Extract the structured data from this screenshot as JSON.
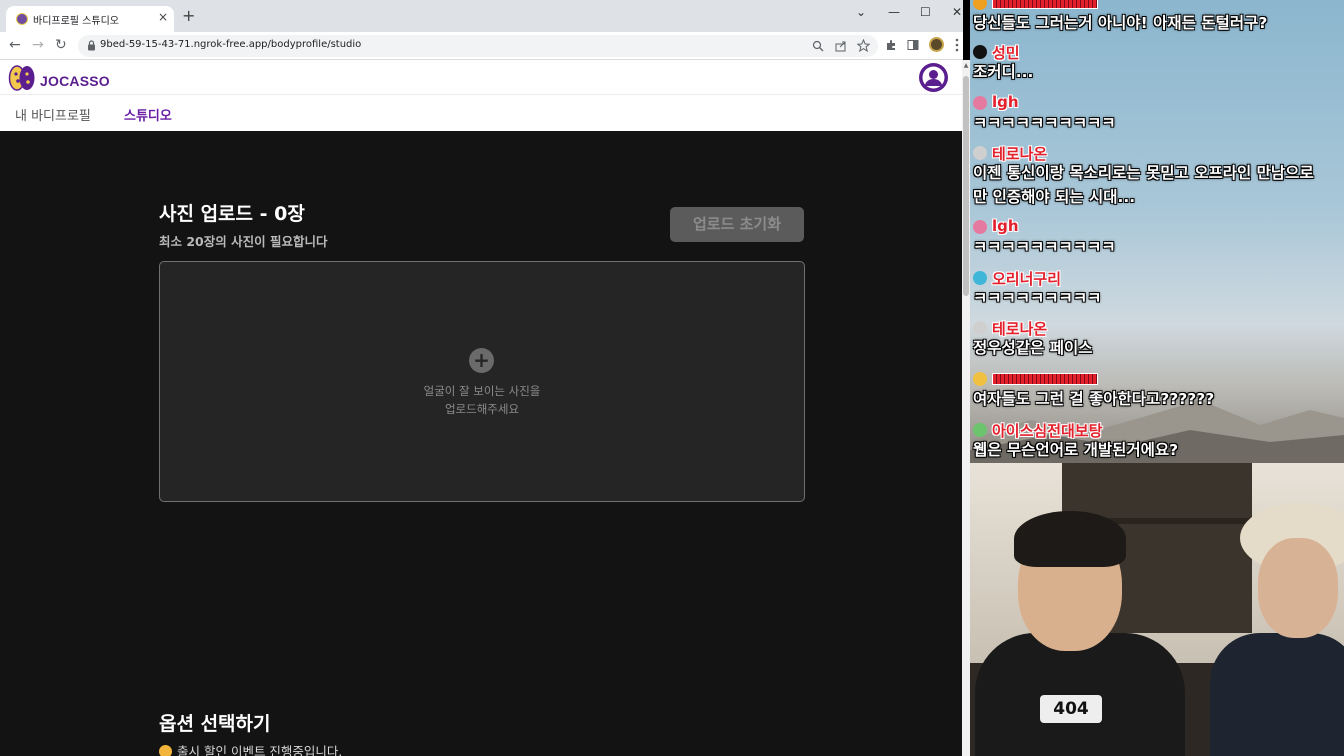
{
  "browser": {
    "tab_title": "바디프로필 스튜디오",
    "tab_close": "×",
    "new_tab": "+",
    "window_controls": {
      "minimize": "—",
      "maximize": "☐",
      "close": "✕",
      "tab_search": "⌄"
    },
    "nav": {
      "back": "←",
      "forward": "→",
      "reload": "↻"
    },
    "url": "9bed-59-15-43-71.ngrok-free.app/bodyprofile/studio",
    "icons": [
      "zoom-icon",
      "share-icon",
      "bookmark-star-icon",
      "extensions-icon",
      "sidepanel-icon",
      "profile-icon",
      "menu-icon"
    ]
  },
  "app": {
    "logo_text": "JOCASSO",
    "nav": {
      "my_profile": "내 바디프로필",
      "studio": "스튜디오"
    },
    "upload": {
      "title": "사진 업로드 - 0장",
      "subtitle": "최소 20장의 사진이 필요합니다",
      "reset_button": "업로드 초기화",
      "dropzone_plus": "+",
      "dropzone_line1": "얼굴이 잘 보이는 사진을",
      "dropzone_line2": "업로드해주세요"
    },
    "options": {
      "title": "옵션 선택하기",
      "promo": "출시 할인 이벤트 진행중입니다."
    },
    "colors": {
      "brand": "#5b1e8f",
      "active_nav": "#6a1fa6",
      "content_bg": "#131313"
    }
  },
  "stream": {
    "chat": [
      {
        "name": "",
        "name_type": "bar",
        "icon_color": "#f0a020",
        "text": "당신들도 그러는거 아니야! 아재든 돈털러구?"
      },
      {
        "name": "성민",
        "name_type": "text",
        "icon_color": "#111111",
        "text": "조커디..."
      },
      {
        "name": "lgh",
        "name_type": "text",
        "icon_color": "#e57aa0",
        "text": "ㅋㅋㅋㅋㅋㅋㅋㅋㅋㅋ"
      },
      {
        "name": "테로나온",
        "name_type": "text",
        "icon_color": "#cfcfcf",
        "text": "이젠 통신이랑 목소리로는 못믿고 오프라인 만남으로",
        "text2": "만 인증해야 되는 시대..."
      },
      {
        "name": "lgh",
        "name_type": "text",
        "icon_color": "#e57aa0",
        "text": "ㅋㅋㅋㅋㅋㅋㅋㅋㅋㅋ"
      },
      {
        "name": "오리너구리",
        "name_type": "text",
        "icon_color": "#3fb6d8",
        "text": "ㅋㅋㅋㅋㅋㅋㅋㅋㅋ"
      },
      {
        "name": "테로나온",
        "name_type": "text",
        "icon_color": "#cfcfcf",
        "text": "정우성같은 페이스"
      },
      {
        "name": "",
        "name_type": "bar",
        "icon_color": "#f0c040",
        "text": "여자들도 그런 걸 좋아한다고??????"
      },
      {
        "name": "아이스심전대보탕",
        "name_type": "text",
        "icon_color": "#6cc46c",
        "text": "웹은 무슨언어로 개발된거에요?"
      }
    ],
    "webcam_shirt": "404"
  }
}
